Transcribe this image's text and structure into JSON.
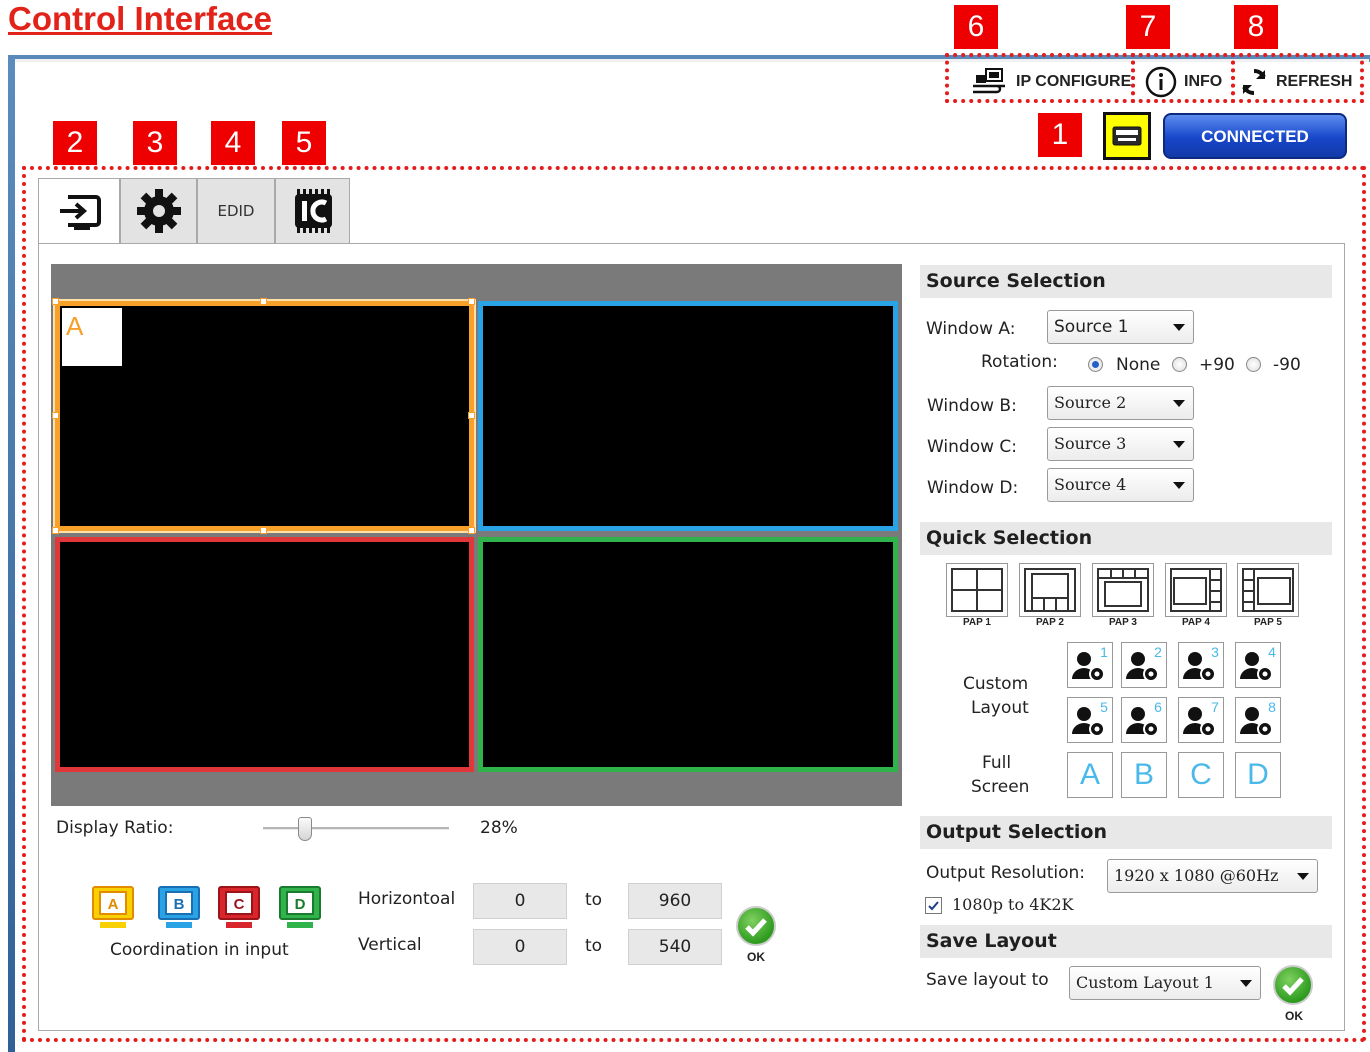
{
  "doc_title": "Control Interface",
  "callouts": [
    "1",
    "2",
    "3",
    "4",
    "5",
    "6",
    "7",
    "8"
  ],
  "toolbar": {
    "ip_configure": "IP CONFIGURE",
    "info": "INFO",
    "refresh": "REFRESH"
  },
  "connection": {
    "status": "CONNECTED"
  },
  "tabs": {
    "edid": "EDID"
  },
  "preview": {
    "window_a_label": "A"
  },
  "display_ratio": {
    "label": "Display Ratio:",
    "value_text": "28%",
    "fraction": 0.28
  },
  "coordination": {
    "caption": "Coordination in input",
    "icons": [
      "A",
      "B",
      "C",
      "D"
    ],
    "horizontal_label": "Horizontoal",
    "vertical_label": "Vertical",
    "to": "to",
    "h_from": "0",
    "h_to": "960",
    "v_from": "0",
    "v_to": "540",
    "ok": "OK"
  },
  "source_selection": {
    "title": "Source Selection",
    "window_a_label": "Window A:",
    "window_a_value": "Source 1",
    "rotation_label": "Rotation:",
    "rotation_options": [
      "None",
      "+90",
      "-90"
    ],
    "rotation_selected": "None",
    "window_b_label": "Window B:",
    "window_b_value": "Source 2",
    "window_c_label": "Window C:",
    "window_c_value": "Source 3",
    "window_d_label": "Window D:",
    "window_d_value": "Source 4"
  },
  "quick_selection": {
    "title": "Quick Selection",
    "pap_labels": [
      "PAP 1",
      "PAP 2",
      "PAP 3",
      "PAP 4",
      "PAP 5"
    ],
    "custom_label_1": "Custom",
    "custom_label_2": "Layout",
    "custom_numbers": [
      "1",
      "2",
      "3",
      "4",
      "5",
      "6",
      "7",
      "8"
    ],
    "full_label_1": "Full",
    "full_label_2": "Screen",
    "full_screen": [
      "A",
      "B",
      "C",
      "D"
    ]
  },
  "output_selection": {
    "title": "Output Selection",
    "resolution_label": "Output Resolution:",
    "resolution_value": "1920 x 1080 @60Hz",
    "upscale_label": "1080p to 4K2K",
    "upscale_checked": true
  },
  "save_layout": {
    "title": "Save Layout",
    "label": "Save layout to",
    "value": "Custom Layout 1",
    "ok": "OK"
  },
  "colors": {
    "accent_red": "#ee0000",
    "window_a": "#f7a02a",
    "window_b": "#2aa3e6",
    "window_c": "#e0373a",
    "window_d": "#2fb34a",
    "connected": "#1746c9"
  }
}
